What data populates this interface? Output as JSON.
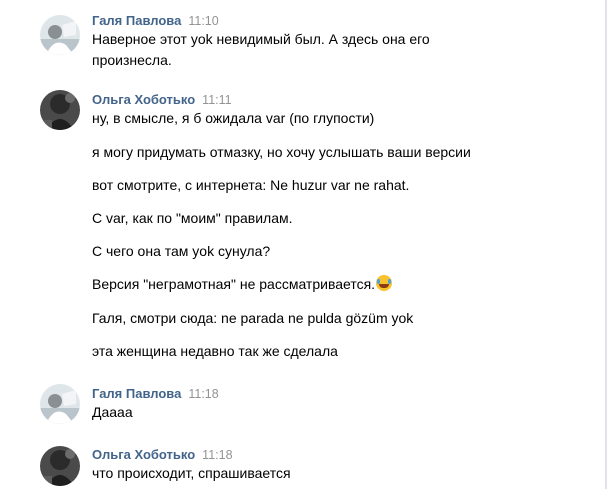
{
  "messages": [
    {
      "author": "Галя Павлова",
      "time": "11:10",
      "lines": [
        "Наверное этот yok невидимый был. А здесь она его",
        "произнесла."
      ]
    },
    {
      "author": "Ольга Хоботько",
      "time": "11:11",
      "lines": [
        "ну, в смысле, я б ожидала var (по глупости)",
        "я могу придумать отмазку, но хочу услышать ваши версии",
        "вот смотрите, с интернета: Ne huzur var ne rahat.",
        "С var, как по \"моим\" правилам.",
        "С чего она там yok сунула?",
        "Версия \"неграмотная\" не рассматривается.",
        "Галя, смотри сюда: ne parada ne pulda gözüm yok",
        "эта женщина недавно так же сделала"
      ],
      "emoji": "face-with-tears-of-joy"
    },
    {
      "author": "Галя Павлова",
      "time": "11:18",
      "lines": [
        "Даааа"
      ]
    },
    {
      "author": "Ольга Хоботько",
      "time": "11:18",
      "lines": [
        "что происходит, спрашивается"
      ]
    }
  ],
  "colors": {
    "author": "#42648b",
    "time": "#939393",
    "text": "#000000",
    "border": "#dfe3e8"
  }
}
